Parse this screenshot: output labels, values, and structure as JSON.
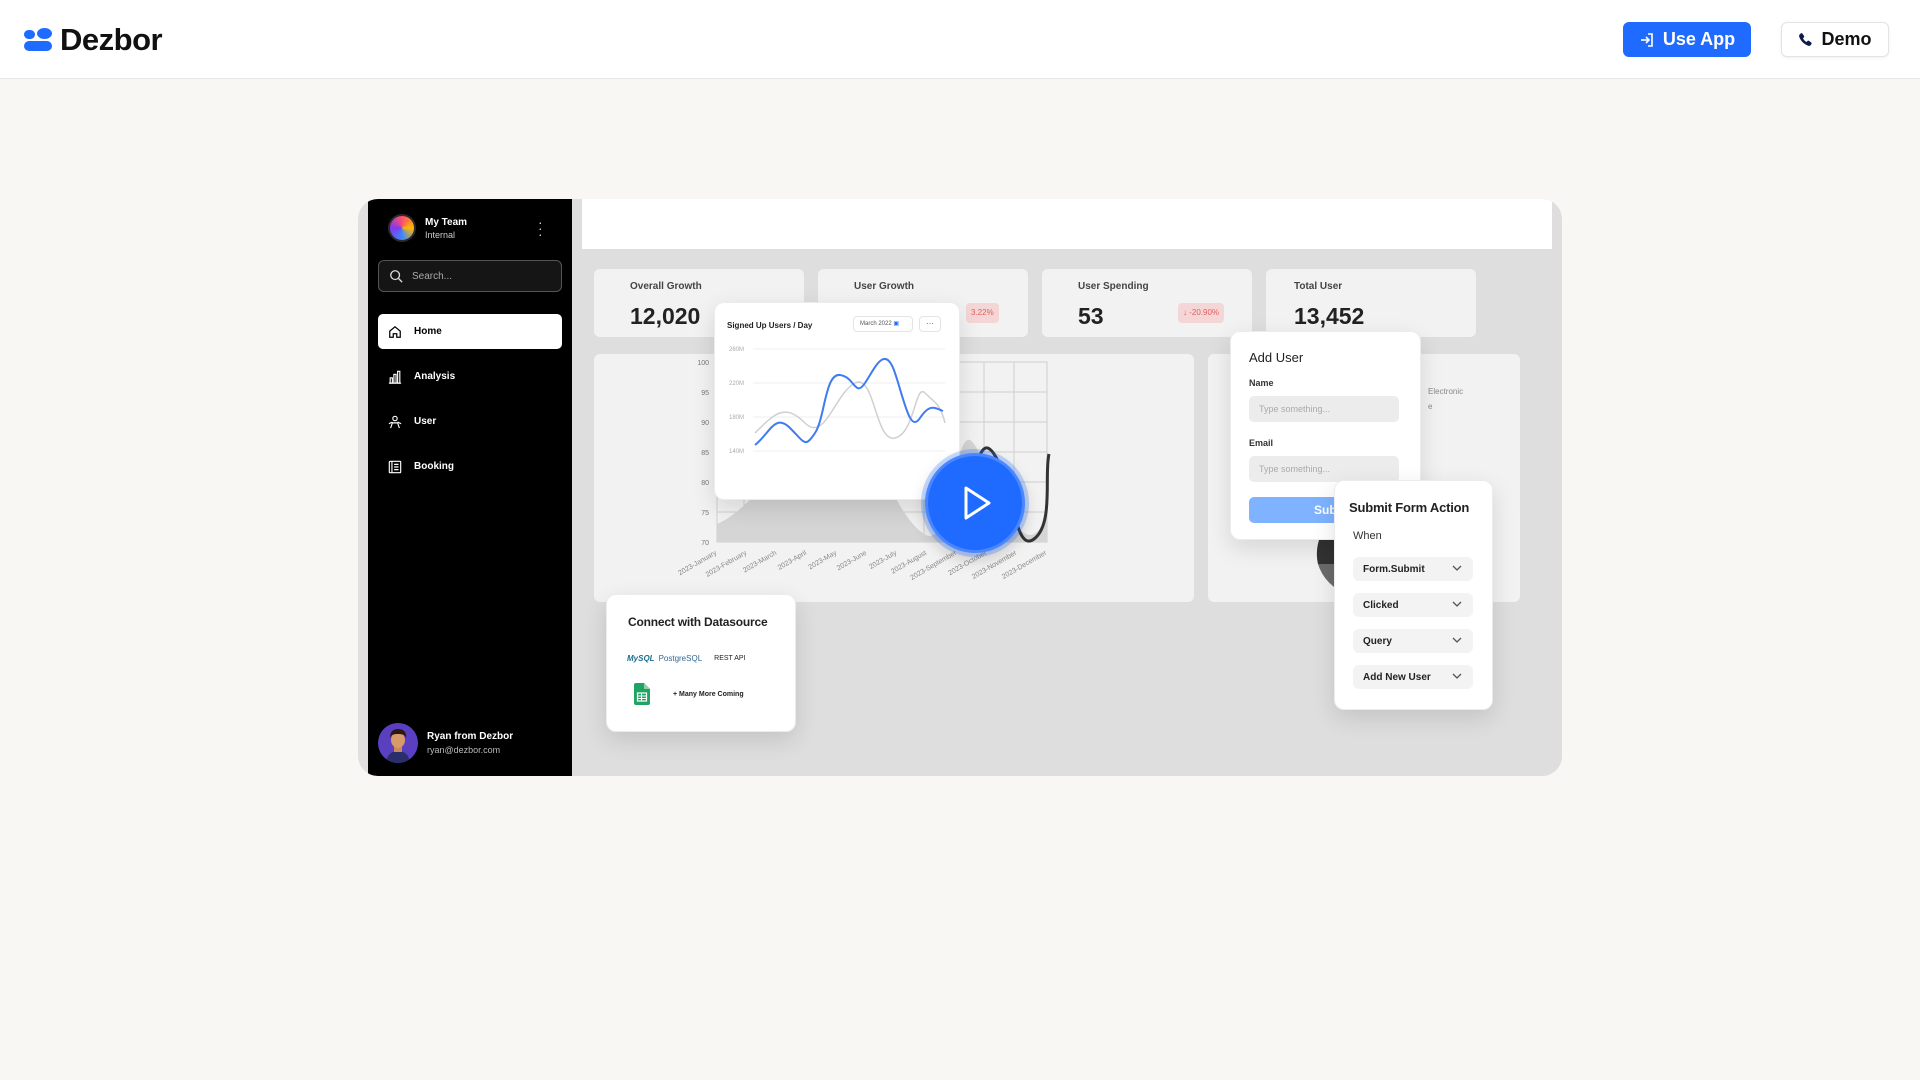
{
  "brand": {
    "name": "Dezbor",
    "color": "#1f6bff"
  },
  "header": {
    "use_app": {
      "label": "Use App",
      "icon": "sign-in-icon"
    },
    "demo": {
      "label": "Demo",
      "icon": "phone-icon"
    }
  },
  "sidebar": {
    "team_name": "My Team",
    "team_sub": "Internal",
    "search_placeholder": "Search...",
    "items": [
      {
        "label": "Home",
        "icon": "home-icon",
        "active": true
      },
      {
        "label": "Analysis",
        "icon": "bar-chart-icon",
        "active": false
      },
      {
        "label": "User",
        "icon": "user-icon",
        "active": false
      },
      {
        "label": "Booking",
        "icon": "booking-icon",
        "active": false
      }
    ],
    "profile": {
      "name": "Ryan from Dezbor",
      "email": "ryan@dezbor.com"
    }
  },
  "stats": [
    {
      "label": "Overall Growth",
      "value": "12,020",
      "badge": ""
    },
    {
      "label": "User Growth",
      "value": "",
      "badge": "3.22%"
    },
    {
      "label": "User Spending",
      "value": "53",
      "badge": "↓ -20.90%"
    },
    {
      "label": "Total User",
      "value": "13,452",
      "badge": ""
    }
  ],
  "main_chart": {
    "y_ticks": [
      "100",
      "95",
      "90",
      "85",
      "80",
      "75",
      "70"
    ],
    "x_ticks": [
      "2023-January",
      "2023-February",
      "2023-March",
      "2023-April",
      "2023-May",
      "2023-June",
      "2023-July",
      "2023-August",
      "2023-September",
      "2023-October",
      "2023-November",
      "2023-December"
    ]
  },
  "pie_legend": "Electronic",
  "signup_card": {
    "title": "Signed Up Users / Day",
    "date": "March 2022",
    "more": "···",
    "y_ticks": [
      "260M",
      "220M",
      "180M",
      "140M"
    ]
  },
  "add_user": {
    "title": "Add User",
    "name_label": "Name",
    "name_placeholder": "Type something...",
    "email_label": "Email",
    "email_placeholder": "Type something...",
    "submit": "Submit"
  },
  "form_action": {
    "title": "Submit Form Action",
    "when": "When",
    "options": [
      "Form.Submit",
      "Clicked",
      "Query",
      "Add New User"
    ]
  },
  "connect": {
    "title": "Connect with Datasource",
    "sources": [
      "MySQL",
      "PostgreSQL",
      "REST API"
    ],
    "more": "Many More Coming"
  }
}
